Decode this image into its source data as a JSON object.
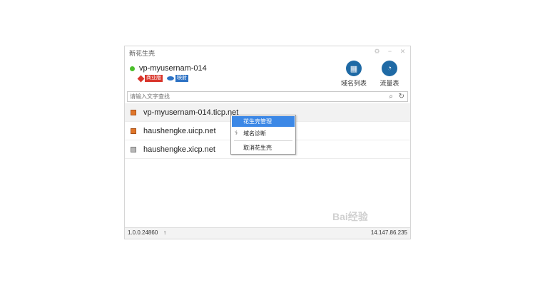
{
  "window": {
    "title": "新花生壳",
    "controls": [
      "settings-icon",
      "minimize-icon",
      "close-icon"
    ]
  },
  "user": {
    "status_color": "#4bbf2b",
    "name": "vp-myusernam-014",
    "badges": [
      {
        "label": "商业版",
        "color": "#d9352b",
        "icon": "diamond-icon"
      },
      {
        "label": "映射",
        "color": "#2d72c4",
        "icon": "eye-icon"
      }
    ]
  },
  "toolbar": {
    "domain_list_label": "域名列表",
    "traffic_label": "流量表"
  },
  "search": {
    "placeholder": "请输入文字查找"
  },
  "domains": [
    {
      "name": "vp-myusernam-014.ticp.net",
      "icon": "orange-box-icon",
      "selected": true
    },
    {
      "name": "haushengke.uicp.net",
      "icon": "orange-box-icon",
      "selected": false
    },
    {
      "name": "haushengke.xicp.net",
      "icon": "gray-box-icon",
      "selected": false
    }
  ],
  "context_menu": {
    "items": [
      {
        "label": "花生壳管理",
        "highlighted": true
      },
      {
        "label": "域名诊断",
        "icon": "diagnose-icon"
      },
      {
        "label": "取消花生壳"
      }
    ]
  },
  "status": {
    "version": "1.0.0.24860",
    "update_icon": "up-arrow-icon",
    "ip": "14.147.86.235"
  },
  "watermark": {
    "text": "Bai经验"
  }
}
